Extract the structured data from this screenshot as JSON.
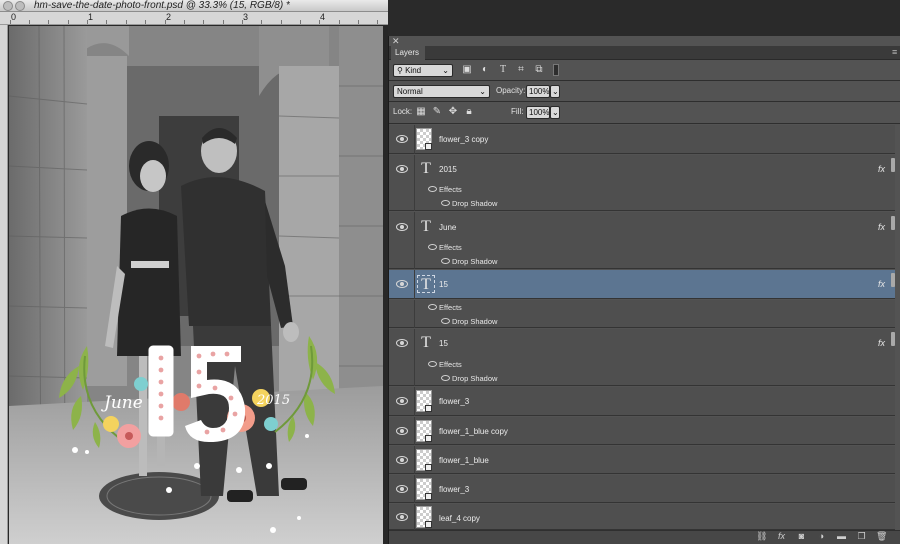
{
  "document": {
    "title": "hm-save-the-date-photo-front.psd @ 33.3% (15, RGB/8) *",
    "ruler_labels": [
      "0",
      "1",
      "2",
      "3",
      "4"
    ],
    "artwork_text": {
      "month": "June",
      "day": "15",
      "year": "2015"
    }
  },
  "panel": {
    "tab_label": "Layers",
    "filter_kind": "Kind",
    "blend_mode": "Normal",
    "opacity_label": "Opacity:",
    "opacity_value": "100%",
    "lock_label": "Lock:",
    "fill_label": "Fill:",
    "fill_value": "100%",
    "layers": [
      {
        "name": "flower_3 copy",
        "kind": "smart"
      },
      {
        "name": "2015",
        "kind": "text",
        "fx": "fx",
        "effects_label": "Effects",
        "effect": "Drop Shadow"
      },
      {
        "name": "June",
        "kind": "text",
        "fx": "fx",
        "effects_label": "Effects",
        "effect": "Drop Shadow"
      },
      {
        "name": "15",
        "kind": "text",
        "fx": "fx",
        "effects_label": "Effects",
        "effect": "Drop Shadow",
        "selected": true
      },
      {
        "name": "15",
        "kind": "text",
        "fx": "fx",
        "effects_label": "Effects",
        "effect": "Drop Shadow"
      },
      {
        "name": "flower_3",
        "kind": "smart"
      },
      {
        "name": "flower_1_blue copy",
        "kind": "smart"
      },
      {
        "name": "flower_1_blue",
        "kind": "smart"
      },
      {
        "name": "flower_3",
        "kind": "smart"
      },
      {
        "name": "leaf_4 copy",
        "kind": "smart"
      }
    ],
    "icons": {
      "text_layer": "T",
      "fx": "fx"
    }
  }
}
